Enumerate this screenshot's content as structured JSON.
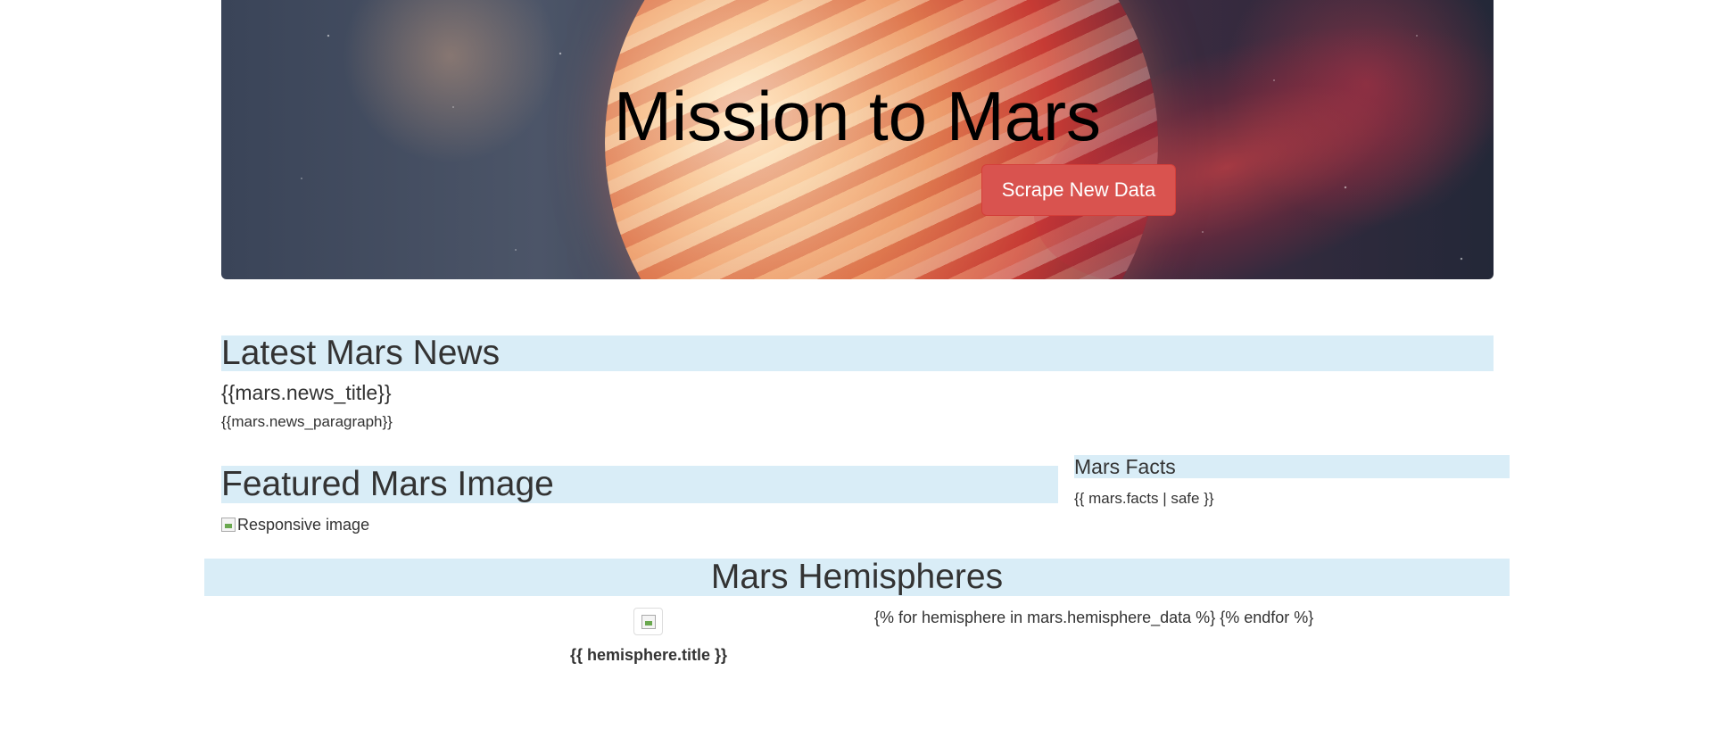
{
  "hero": {
    "title": "Mission to Mars",
    "button_label": "Scrape New Data",
    "button_color": "#d9534f"
  },
  "news": {
    "heading": "Latest Mars News",
    "title": "{{mars.news_title}}",
    "paragraph": "{{mars.news_paragraph}}"
  },
  "featured": {
    "heading": "Featured Mars Image",
    "image_alt": "Responsive image"
  },
  "facts": {
    "heading": "Mars Facts",
    "content": "{{ mars.facts | safe }}"
  },
  "hemispheres": {
    "heading": "Mars Hemispheres",
    "item_title": "{{ hemisphere.title }}",
    "loop_text": "{% for hemisphere in mars.hemisphere_data %} {% endfor %}"
  },
  "colors": {
    "section_band": "#d9edf7",
    "text": "#333333"
  }
}
